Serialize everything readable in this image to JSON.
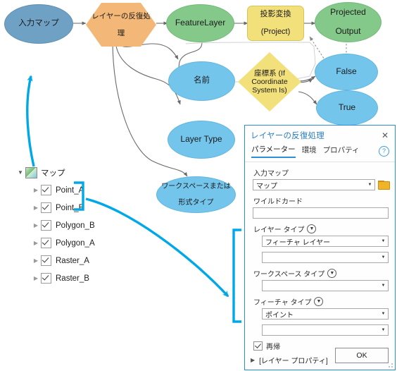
{
  "diagram": {
    "nodes": [
      {
        "id": "input-map",
        "label": "入力マップ",
        "shape": "ellipse",
        "color": "#6fa1c4"
      },
      {
        "id": "iterate-layers",
        "label": "レイヤーの反復処理",
        "shape": "hexagon",
        "color": "#f3b877"
      },
      {
        "id": "feature-layer",
        "label": "FeatureLayer",
        "shape": "ellipse",
        "color": "#84c98a"
      },
      {
        "id": "project",
        "label": "投影変換\n(Project)",
        "shape": "rounded",
        "color": "#f2e07a"
      },
      {
        "id": "projected-output",
        "label": "Projected\nOutput",
        "shape": "ellipse",
        "color": "#84c98a"
      },
      {
        "id": "name",
        "label": "名前",
        "shape": "ellipse",
        "color": "#74c5ec"
      },
      {
        "id": "coordinate-system",
        "label": "座標系 (If\nCoordinate\nSystem Is)",
        "shape": "diamond",
        "color": "#f2e07a"
      },
      {
        "id": "false-output",
        "label": "False",
        "shape": "ellipse",
        "color": "#74c5ec"
      },
      {
        "id": "true-output",
        "label": "True",
        "shape": "ellipse",
        "color": "#74c5ec"
      },
      {
        "id": "layer-type",
        "label": "Layer Type",
        "shape": "ellipse",
        "color": "#74c5ec"
      },
      {
        "id": "workspace-type",
        "label": "ワークスペースまたは\n形式タイプ",
        "shape": "ellipse",
        "color": "#74c5ec"
      }
    ],
    "node_labels": {
      "input_map": "入力マップ",
      "iterate_layers_1": "レイヤーの反復処",
      "iterate_layers_2": "理",
      "feature_layer": "FeatureLayer",
      "project_1": "投影変換",
      "project_2": "(Project)",
      "projected_output_1": "Projected",
      "projected_output_2": "Output",
      "name": "名前",
      "coord_1": "座標系 (If",
      "coord_2": "Coordinate",
      "coord_3": "System Is)",
      "false_label": "False",
      "true_label": "True",
      "layer_type": "Layer Type",
      "workspace_1": "ワークスペースまたは",
      "workspace_2": "形式タイプ"
    },
    "annotation_color": "#00a8e8"
  },
  "tree": {
    "root": {
      "label": "マップ",
      "expanded": true
    },
    "items": [
      {
        "label": "Point_A",
        "checked": true
      },
      {
        "label": "Point_B",
        "checked": true
      },
      {
        "label": "Polygon_B",
        "checked": true
      },
      {
        "label": "Polygon_A",
        "checked": true
      },
      {
        "label": "Raster_A",
        "checked": true
      },
      {
        "label": "Raster_B",
        "checked": true
      }
    ]
  },
  "dialog": {
    "title": "レイヤーの反復処理",
    "close_label": "✕",
    "help_label": "?",
    "tabs": [
      {
        "label": "パラメーター",
        "active": true
      },
      {
        "label": "環境",
        "active": false
      },
      {
        "label": "プロパティ",
        "active": false
      }
    ],
    "fields": {
      "input_map": {
        "label": "入力マップ",
        "value": "マップ"
      },
      "wildcard": {
        "label": "ワイルドカード",
        "value": ""
      },
      "layer_type": {
        "label": "レイヤー タイプ",
        "value1": "フィーチャ レイヤー",
        "value2": ""
      },
      "workspace_type": {
        "label": "ワークスペース タイプ",
        "value1": ""
      },
      "feature_type": {
        "label": "フィーチャ タイプ",
        "value1": "ポイント",
        "value2": ""
      },
      "recursive": {
        "label": "再帰",
        "checked": true
      },
      "layer_properties": {
        "label": "[レイヤー プロパティ]"
      }
    },
    "ok_label": "OK"
  }
}
